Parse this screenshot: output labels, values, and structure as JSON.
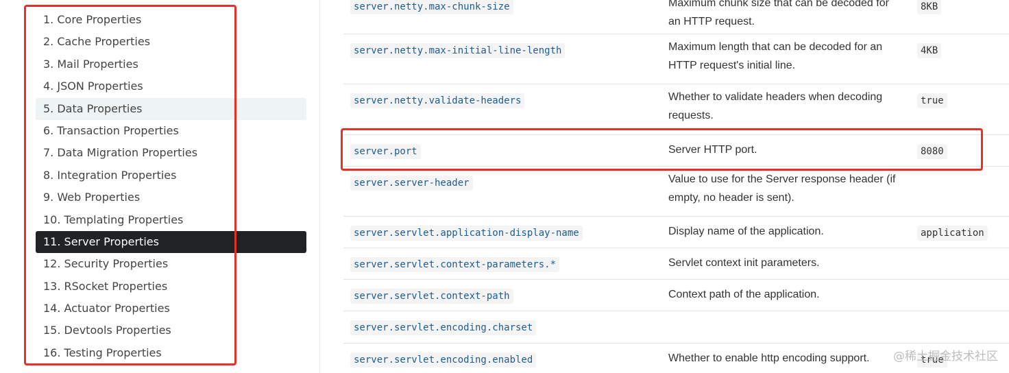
{
  "sidebar": {
    "items": [
      {
        "label": "1. Core Properties"
      },
      {
        "label": "2. Cache Properties"
      },
      {
        "label": "3. Mail Properties"
      },
      {
        "label": "4. JSON Properties"
      },
      {
        "label": "5. Data Properties"
      },
      {
        "label": "6. Transaction Properties"
      },
      {
        "label": "7. Data Migration Properties"
      },
      {
        "label": "8. Integration Properties"
      },
      {
        "label": "9. Web Properties"
      },
      {
        "label": "10. Templating Properties"
      },
      {
        "label": "11. Server Properties"
      },
      {
        "label": "12. Security Properties"
      },
      {
        "label": "13. RSocket Properties"
      },
      {
        "label": "14. Actuator Properties"
      },
      {
        "label": "15. Devtools Properties"
      },
      {
        "label": "16. Testing Properties"
      }
    ],
    "hover_item": "5. Data Properties",
    "active_item": "11. Server Properties"
  },
  "table": {
    "rows": [
      {
        "name": "server.netty.max-chunk-size",
        "desc_lines": [
          "Maximum chunk size that can be decoded for",
          "an HTTP request."
        ],
        "default": "8KB"
      },
      {
        "name": "server.netty.max-initial-line-length",
        "desc_lines": [
          "Maximum length that can be decoded for an",
          "HTTP request's initial line."
        ],
        "default": "4KB"
      },
      {
        "name": "server.netty.validate-headers",
        "desc_lines": [
          "Whether to validate headers when decoding",
          "requests."
        ],
        "default": "true"
      },
      {
        "name": "server.port",
        "desc_lines": [
          "Server HTTP port."
        ],
        "default": "8080"
      },
      {
        "name": "server.server-header",
        "desc_lines": [
          "Value to use for the Server response header (if",
          "empty, no header is sent)."
        ],
        "default": ""
      },
      {
        "name": "server.servlet.application-display-name",
        "desc_lines": [
          "Display name of the application."
        ],
        "default": "application"
      },
      {
        "name": "server.servlet.context-parameters.*",
        "desc_lines": [
          "Servlet context init parameters."
        ],
        "default": ""
      },
      {
        "name": "server.servlet.context-path",
        "desc_lines": [
          "Context path of the application."
        ],
        "default": ""
      },
      {
        "name": "server.servlet.encoding.charset",
        "desc_lines": [
          ""
        ],
        "default": ""
      },
      {
        "name": "server.servlet.encoding.enabled",
        "desc_lines": [
          "Whether to enable http encoding support."
        ],
        "default": "true"
      }
    ]
  },
  "watermark": "@稀土掘金技术社区"
}
